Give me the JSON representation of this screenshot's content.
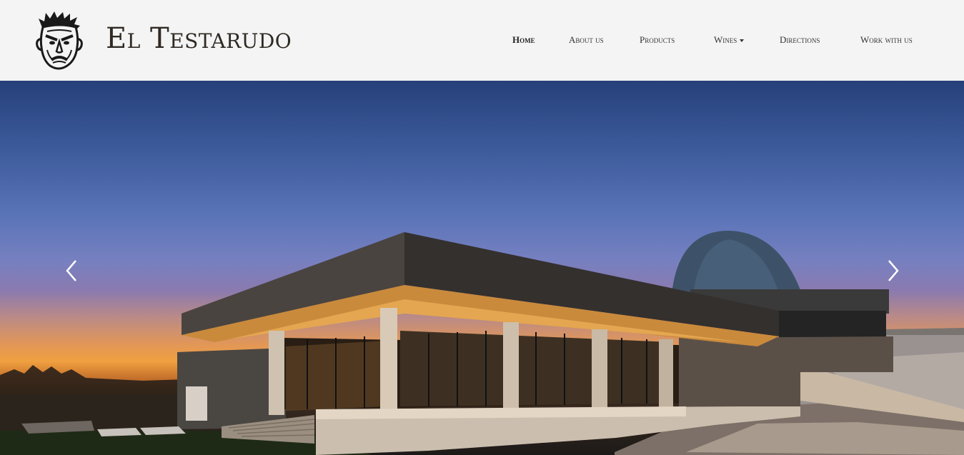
{
  "header": {
    "brand": "El Testarudo",
    "logo_icon": "grumpy-face-logo-icon"
  },
  "nav": {
    "items": [
      {
        "label": "Home",
        "active": true
      },
      {
        "label": "About us",
        "active": false
      },
      {
        "label": "Products",
        "active": false
      },
      {
        "label": "Wines",
        "active": false,
        "dropdown": true
      },
      {
        "label": "Directions",
        "active": false
      },
      {
        "label": "Work with us",
        "active": false
      }
    ]
  },
  "carousel": {
    "prev_icon": "chevron-left-icon",
    "next_icon": "chevron-right-icon",
    "slide_subject": "winery-building-at-dusk"
  }
}
